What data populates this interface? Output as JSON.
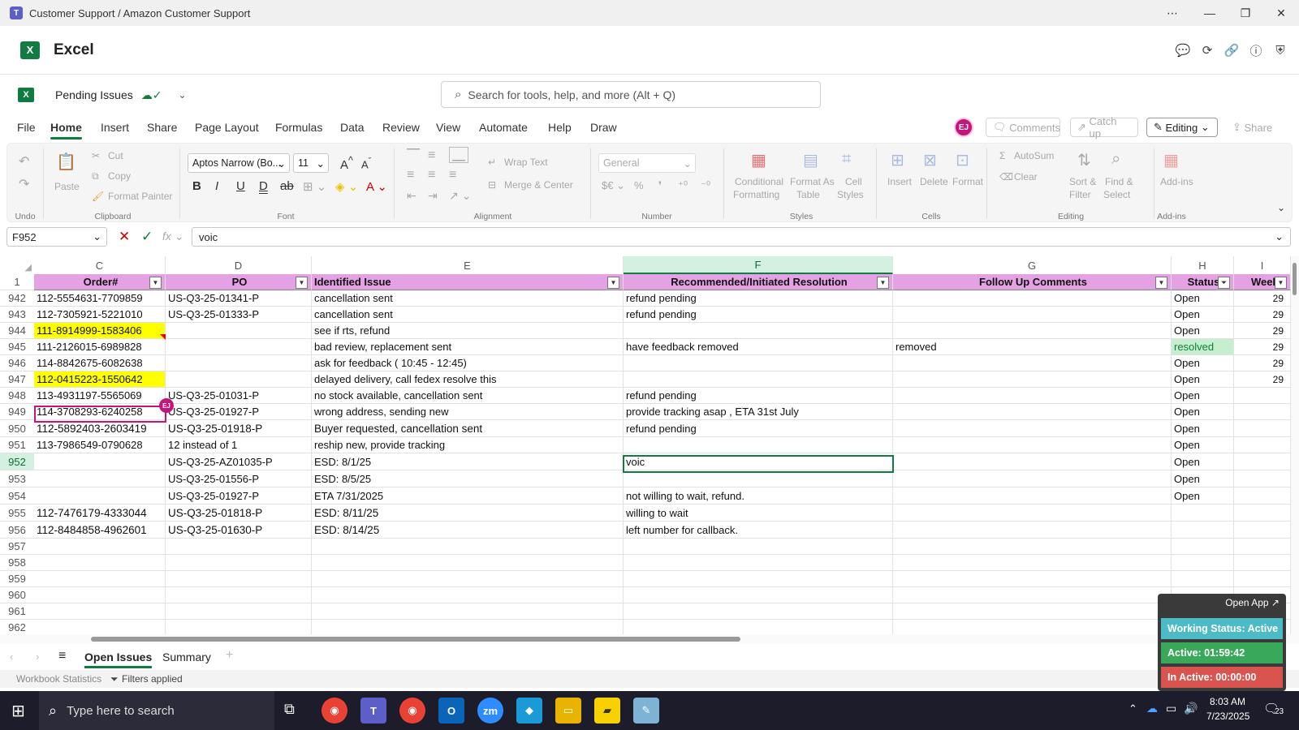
{
  "window": {
    "title": "Customer Support / Amazon Customer Support"
  },
  "app": {
    "name": "Excel"
  },
  "doc": {
    "name": "Pending Issues"
  },
  "search": {
    "placeholder": "Search for tools, help, and more (Alt + Q)"
  },
  "menu_tabs": [
    "File",
    "Home",
    "Insert",
    "Share",
    "Page Layout",
    "Formulas",
    "Data",
    "Review",
    "View",
    "Automate",
    "Help",
    "Draw"
  ],
  "header_buttons": {
    "comments": "Comments",
    "catchup": "Catch up",
    "editing": "Editing",
    "share": "Share",
    "avatar": "EJ"
  },
  "ribbon": {
    "undo_group": "Undo",
    "clipboard": {
      "label": "Clipboard",
      "paste": "Paste",
      "cut": "Cut",
      "copy": "Copy",
      "format_painter": "Format Painter"
    },
    "font": {
      "label": "Font",
      "family": "Aptos Narrow (Bo...",
      "size": "11"
    },
    "alignment": {
      "label": "Alignment",
      "wrap": "Wrap Text",
      "merge": "Merge & Center"
    },
    "number": {
      "label": "Number",
      "format": "General"
    },
    "styles": {
      "label": "Styles",
      "conditional": "Conditional",
      "conditional2": "Formatting",
      "format_as": "Format As",
      "format_as2": "Table",
      "cell_styles": "Cell",
      "cell_styles2": "Styles"
    },
    "cells": {
      "label": "Cells",
      "insert": "Insert",
      "delete": "Delete",
      "format": "Format"
    },
    "editing": {
      "label": "Editing",
      "autosum": "AutoSum",
      "clear": "Clear",
      "sort": "Sort &",
      "sort2": "Filter",
      "find": "Find &",
      "find2": "Select"
    },
    "addins": {
      "label": "Add-ins",
      "btn": "Add-ins"
    }
  },
  "formula_bar": {
    "name_box": "F952",
    "value": "voic"
  },
  "columns": {
    "C": "C",
    "D": "D",
    "E": "E",
    "F": "F",
    "G": "G",
    "H": "H",
    "I": "I"
  },
  "table_headers": {
    "order": "Order#",
    "po": "PO",
    "issue": "Identified Issue",
    "resolution": "Recommended/Initiated Resolution",
    "followup": "Follow Up Comments",
    "status": "Status",
    "week": "Weel"
  },
  "rows": [
    {
      "n": "942",
      "order": "112-5554631-7709859",
      "po": "US-Q3-25-01341-P",
      "issue": "cancellation sent",
      "res": "refund pending",
      "follow": "",
      "status": "Open",
      "week": "29"
    },
    {
      "n": "943",
      "order": "112-7305921-5221010",
      "po": "US-Q3-25-01333-P",
      "issue": "cancellation sent",
      "res": "refund pending",
      "follow": "",
      "status": "Open",
      "week": "29"
    },
    {
      "n": "944",
      "order": "111-8914999-1583406",
      "po": "",
      "issue": "see if rts, refund",
      "res": "",
      "follow": "",
      "status": "Open",
      "week": "29"
    },
    {
      "n": "945",
      "order": "111-2126015-6989828",
      "po": "",
      "issue": "bad review, replacement sent",
      "res": "have feedback removed",
      "follow": "removed",
      "status": "resolved",
      "week": "29"
    },
    {
      "n": "946",
      "order": "114-8842675-6082638",
      "po": "",
      "issue": "ask for feedback ( 10:45 - 12:45)",
      "res": "",
      "follow": "",
      "status": "Open",
      "week": "29"
    },
    {
      "n": "947",
      "order": "112-0415223-1550642",
      "po": "",
      "issue": "delayed delivery, call fedex resolve this",
      "res": "",
      "follow": "",
      "status": "Open",
      "week": "29"
    },
    {
      "n": "948",
      "order": "113-4931197-5565069",
      "po": "US-Q3-25-01031-P",
      "issue": "no stock available, cancellation sent",
      "res": "refund pending",
      "follow": "",
      "status": "Open",
      "week": ""
    },
    {
      "n": "949",
      "order": "114-3708293-6240258",
      "po": "US-Q3-25-01927-P",
      "issue": "wrong address, sending new",
      "res": "provide tracking asap , ETA 31st July",
      "follow": "",
      "status": "Open",
      "week": ""
    },
    {
      "n": "950",
      "order": "112-5892403-2603419",
      "po": "US-Q3-25-01918-P",
      "issue": "Buyer requested, cancellation sent",
      "res": "refund pending",
      "follow": "",
      "status": "Open",
      "week": ""
    },
    {
      "n": "951",
      "order": "113-7986549-0790628",
      "po": "12 instead of 1",
      "issue": "reship new, provide tracking",
      "res": "",
      "follow": "",
      "status": "Open",
      "week": ""
    },
    {
      "n": "952",
      "order": "",
      "po": "US-Q3-25-AZ01035-P",
      "issue": " ESD: 8/1/25",
      "res": "voic",
      "follow": "",
      "status": "Open",
      "week": ""
    },
    {
      "n": "953",
      "order": "",
      "po": "US-Q3-25-01556-P",
      "issue": "ESD:  8/5/25",
      "res": "",
      "follow": "",
      "status": "Open",
      "week": ""
    },
    {
      "n": "954",
      "order": "",
      "po": "US-Q3-25-01927-P",
      "issue": "ETA 7/31/2025",
      "res": "not willing to wait, refund.",
      "follow": "",
      "status": "Open",
      "week": ""
    },
    {
      "n": "955",
      "order": "112-7476179-4333044",
      "po": "US-Q3-25-01818-P",
      "issue": "ESD: 8/11/25",
      "res": "willing to wait",
      "follow": "",
      "status": "",
      "week": ""
    },
    {
      "n": "956",
      "order": "112-8484858-4962601",
      "po": "US-Q3-25-01630-P",
      "issue": " ESD: 8/14/25",
      "res": "left number for callback.",
      "follow": "",
      "status": "",
      "week": ""
    },
    {
      "n": "957",
      "order": "",
      "po": "",
      "issue": "",
      "res": "",
      "follow": "",
      "status": "",
      "week": ""
    },
    {
      "n": "958",
      "order": "",
      "po": "",
      "issue": "",
      "res": "",
      "follow": "",
      "status": "",
      "week": ""
    },
    {
      "n": "959",
      "order": "",
      "po": "",
      "issue": "",
      "res": "",
      "follow": "",
      "status": "",
      "week": ""
    },
    {
      "n": "960",
      "order": "",
      "po": "",
      "issue": "",
      "res": "",
      "follow": "",
      "status": "",
      "week": ""
    },
    {
      "n": "961",
      "order": "",
      "po": "",
      "issue": "",
      "res": "",
      "follow": "",
      "status": "",
      "week": ""
    },
    {
      "n": "962",
      "order": "",
      "po": "",
      "issue": "",
      "res": "",
      "follow": "",
      "status": "",
      "week": ""
    }
  ],
  "header_row_num": "1",
  "sheets": {
    "active": "Open Issues",
    "other": "Summary"
  },
  "status": {
    "stats": "Workbook Statistics",
    "filters": "Filters applied"
  },
  "widget": {
    "open": "Open App ↗",
    "working": "Working Status: Active",
    "active": "Active: 01:59:42",
    "inactive": "In Active: 00:00:00"
  },
  "taskbar": {
    "search": "Type here to search",
    "time": "8:03 AM",
    "date": "7/23/2025",
    "notif": "23"
  },
  "colors": {
    "header": "#e4a1e4",
    "highlight": "#ffff00",
    "resolved": "#c6efce",
    "accent": "#107c41"
  }
}
